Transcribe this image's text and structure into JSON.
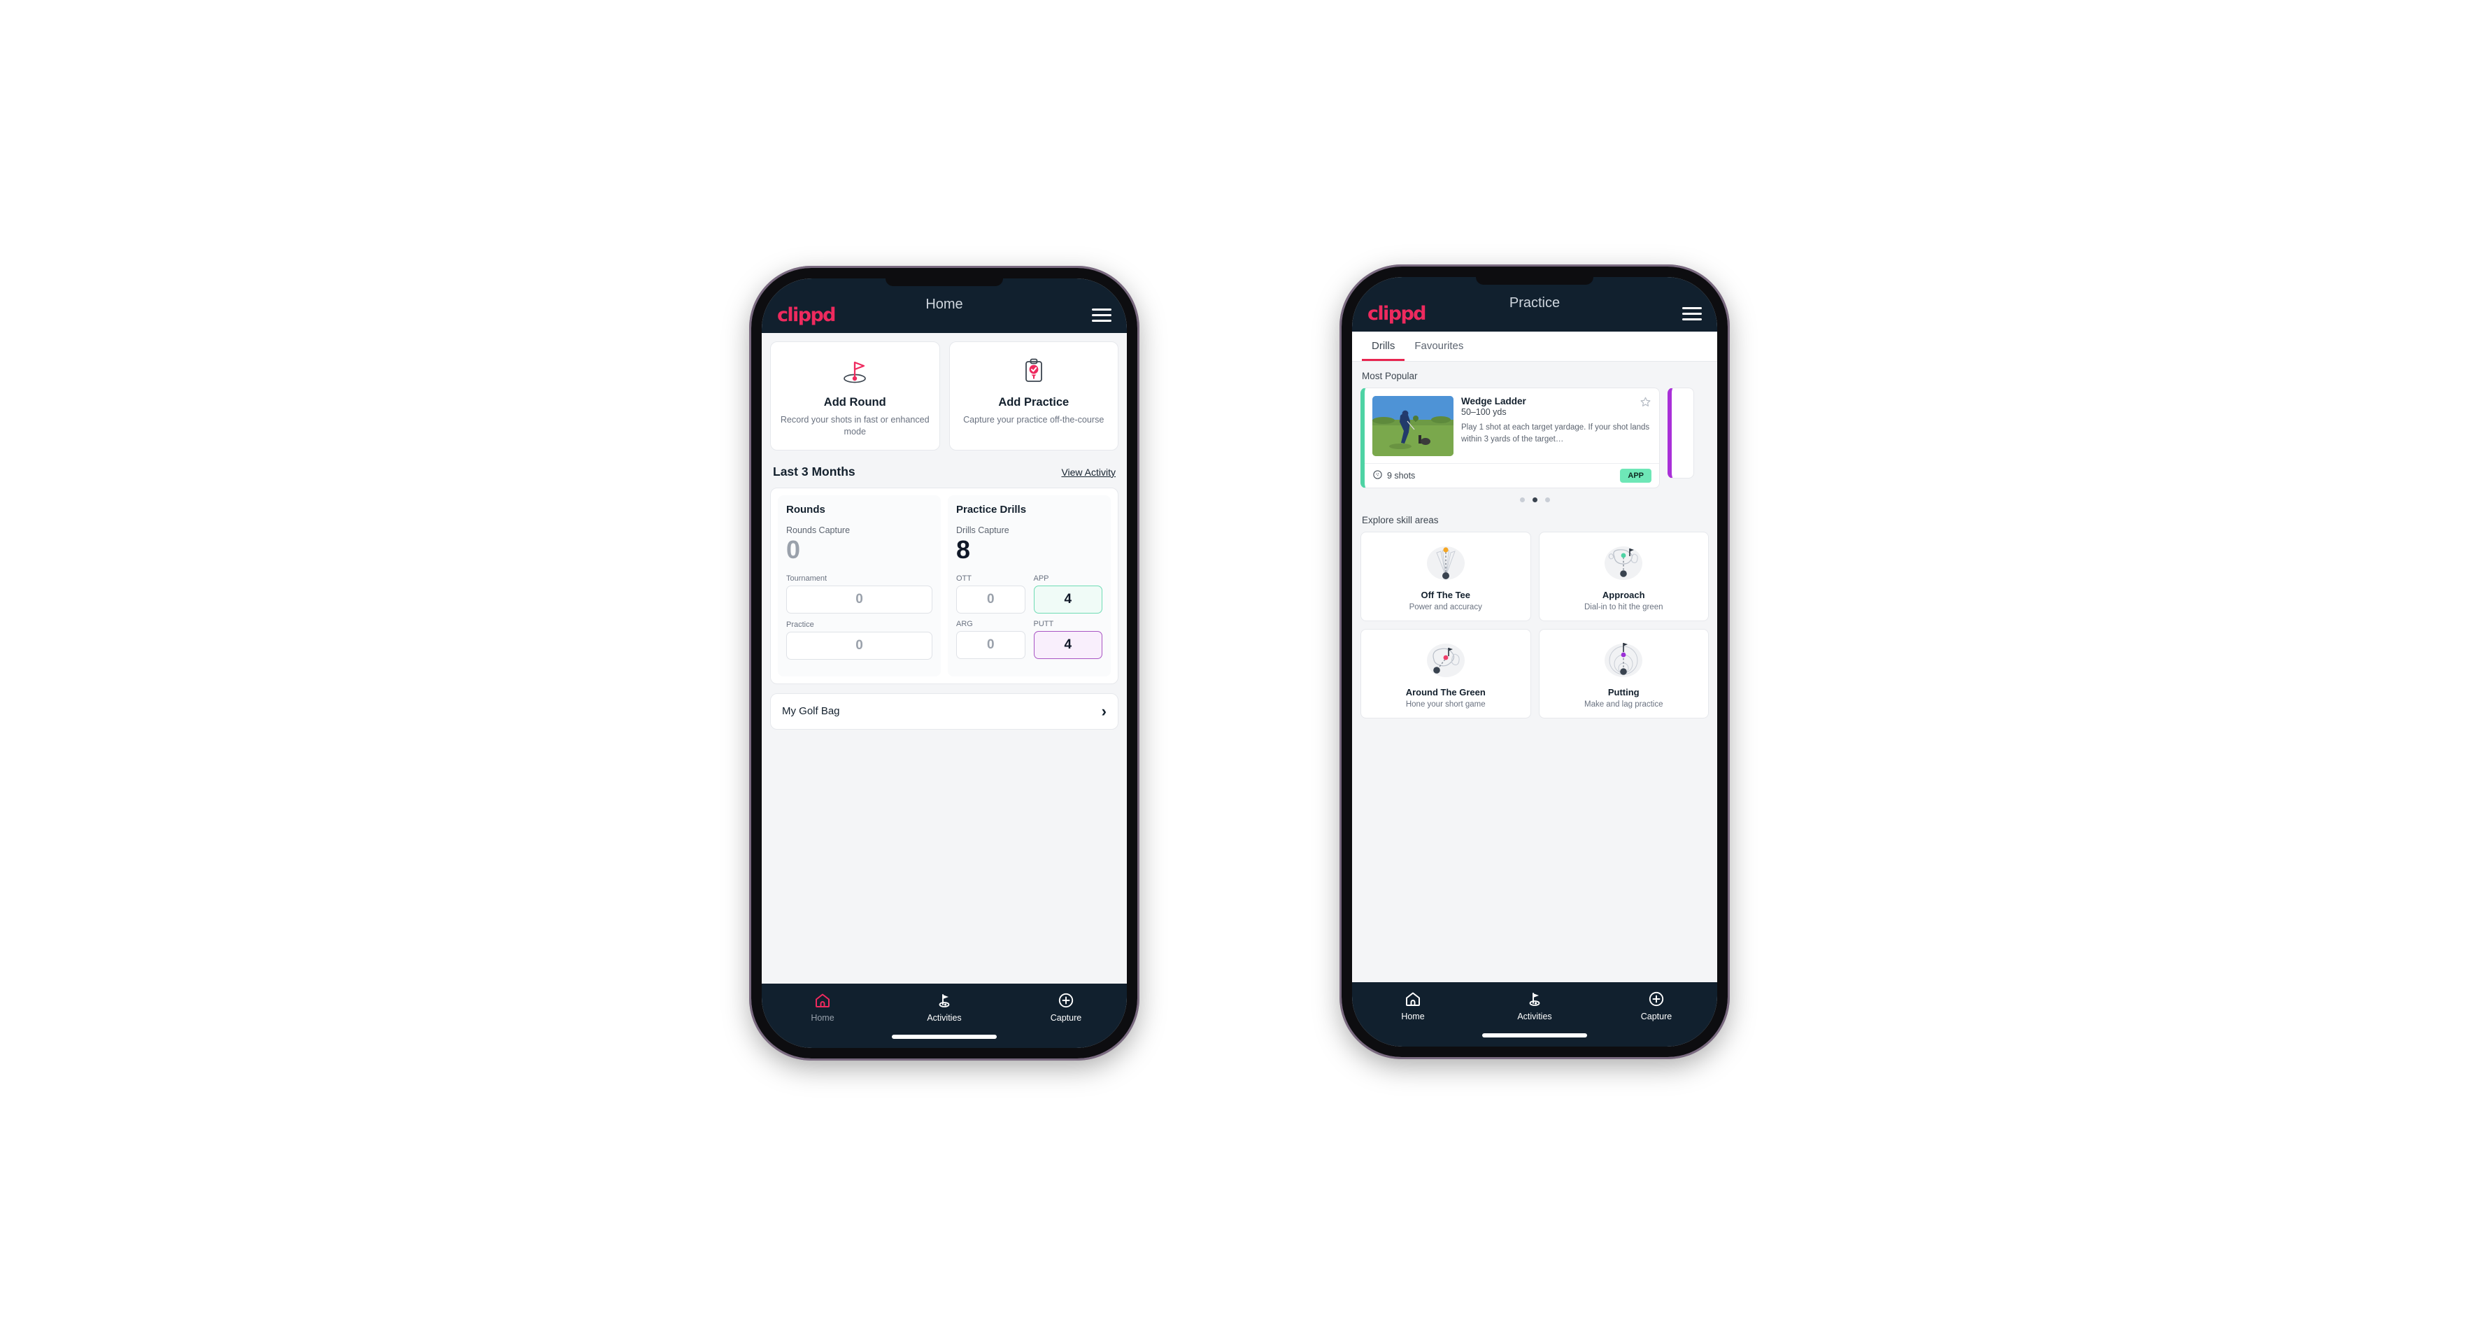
{
  "accent": {
    "brand_pink": "#ee2a5e",
    "navy": "#11202e",
    "app_green": "#6ee7b7",
    "putt_purple": "#a855c4"
  },
  "phone_home": {
    "appbar": {
      "logo": "clippd",
      "title": "Home",
      "menu_icon": "hamburger-icon"
    },
    "actions": [
      {
        "icon": "golf-flag-hole-icon",
        "title": "Add Round",
        "subtitle": "Record your shots in fast or enhanced mode"
      },
      {
        "icon": "clipboard-check-tee-icon",
        "title": "Add Practice",
        "subtitle": "Capture your practice off-the-course"
      }
    ],
    "section": {
      "title": "Last 3 Months",
      "link": "View Activity"
    },
    "rounds": {
      "title": "Rounds",
      "capture_label": "Rounds Capture",
      "capture_value": "0",
      "metrics": [
        {
          "label": "Tournament",
          "value": "0",
          "state": "zero"
        },
        {
          "label": "Practice",
          "value": "0",
          "state": "zero"
        }
      ]
    },
    "drills": {
      "title": "Practice Drills",
      "capture_label": "Drills Capture",
      "capture_value": "8",
      "metrics": [
        {
          "label": "OTT",
          "value": "0",
          "state": "zero"
        },
        {
          "label": "APP",
          "value": "4",
          "state": "app"
        },
        {
          "label": "ARG",
          "value": "0",
          "state": "zero"
        },
        {
          "label": "PUTT",
          "value": "4",
          "state": "putt"
        }
      ]
    },
    "golf_bag": {
      "label": "My Golf Bag",
      "chevron": "chevron-right-icon"
    },
    "nav": [
      {
        "icon": "home-icon",
        "label": "Home",
        "active": true
      },
      {
        "icon": "golf-flag-icon",
        "label": "Activities",
        "active": false
      },
      {
        "icon": "plus-circle-icon",
        "label": "Capture",
        "active": false
      }
    ]
  },
  "phone_practice": {
    "appbar": {
      "logo": "clippd",
      "title": "Practice",
      "menu_icon": "hamburger-icon"
    },
    "tabs": [
      {
        "label": "Drills",
        "active": true
      },
      {
        "label": "Favourites",
        "active": false
      }
    ],
    "most_popular_label": "Most Popular",
    "drill": {
      "title": "Wedge Ladder",
      "yardage": "50–100 yds",
      "description": "Play 1 shot at each target yardage. If your shot lands within 3 yards of the target…",
      "shots": "9 shots",
      "shots_icon": "golf-ball-icon",
      "chip": "APP",
      "star_icon": "star-outline-icon",
      "thumb": "golfer-chipping-photo"
    },
    "carousel_dots": [
      false,
      true,
      false
    ],
    "skill_label": "Explore skill areas",
    "skills": [
      {
        "icon": "tee-shot-dispersion-icon",
        "name": "Off The Tee",
        "sub": "Power and accuracy"
      },
      {
        "icon": "approach-green-icon",
        "name": "Approach",
        "sub": "Dial-in to hit the green"
      },
      {
        "icon": "around-green-icon",
        "name": "Around The Green",
        "sub": "Hone your short game"
      },
      {
        "icon": "putting-rings-icon",
        "name": "Putting",
        "sub": "Make and lag practice"
      }
    ],
    "nav": [
      {
        "icon": "home-icon",
        "label": "Home",
        "active": false
      },
      {
        "icon": "golf-flag-icon",
        "label": "Activities",
        "active": false
      },
      {
        "icon": "plus-circle-icon",
        "label": "Capture",
        "active": false
      }
    ]
  }
}
